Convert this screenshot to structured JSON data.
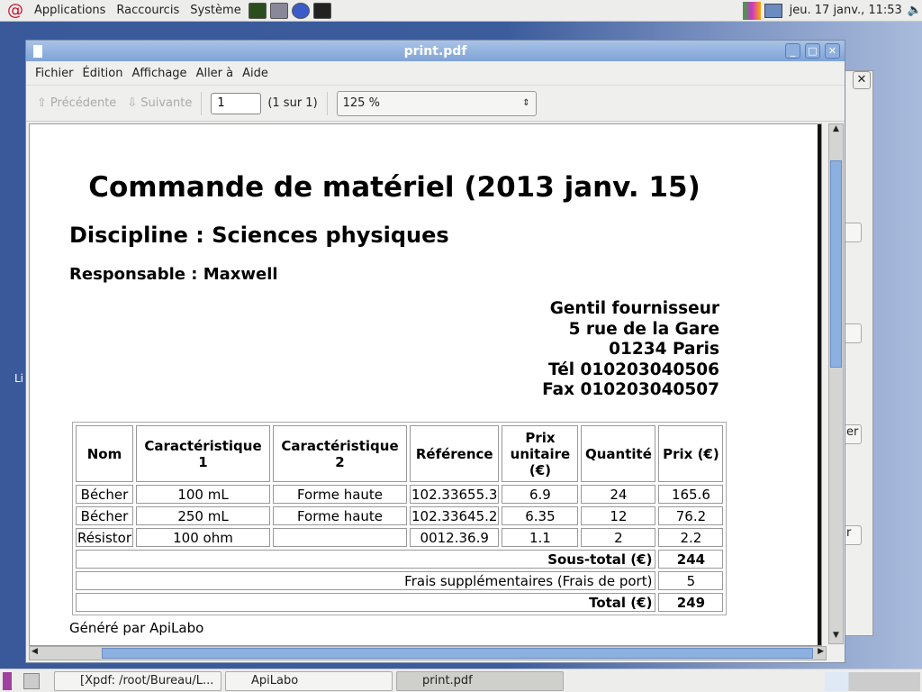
{
  "panel": {
    "menus": [
      "Applications",
      "Raccourcis",
      "Système"
    ],
    "clock": "jeu. 17 janv., 11:53"
  },
  "window": {
    "title": "print.pdf",
    "menu": [
      "Fichier",
      "Édition",
      "Affichage",
      "Aller à",
      "Aide"
    ],
    "toolbar": {
      "prev": "Précédente",
      "next": "Suivante",
      "page": "1",
      "page_of": "(1 sur 1)",
      "zoom": "125 %"
    }
  },
  "document": {
    "title": "Commande de matériel (2013 janv. 15)",
    "discipline": "Discipline : Sciences physiques",
    "responsable": "Responsable : Maxwell",
    "supplier": [
      "Gentil fournisseur",
      "5 rue de la Gare",
      "01234 Paris",
      "Tél 010203040506",
      "Fax 010203040507"
    ],
    "headers": [
      "Nom",
      "Caractéristique 1",
      "Caractéristique 2",
      "Référence",
      "Prix unitaire (€)",
      "Quantité",
      "Prix (€)"
    ],
    "rows": [
      [
        "Bécher",
        "100 mL",
        "Forme haute",
        "102.33655.3",
        "6.9",
        "24",
        "165.6"
      ],
      [
        "Bécher",
        "250 mL",
        "Forme haute",
        "102.33645.2",
        "6.35",
        "12",
        "76.2"
      ],
      [
        "Résistor",
        "100 ohm",
        "",
        "0012.36.9",
        "1.1",
        "2",
        "2.2"
      ]
    ],
    "subtotal_label": "Sous-total (€)",
    "subtotal": "244",
    "fees_label": "Frais supplémentaires (Frais de port)",
    "fees": "5",
    "total_label": "Total (€)",
    "total": "249",
    "footer": "Généré par ApiLabo"
  },
  "background_window": {
    "buttons": [
      "er",
      "r"
    ]
  },
  "taskbar": {
    "tasks": [
      "[Xpdf: /root/Bureau/L...",
      "ApiLabo",
      "print.pdf"
    ]
  },
  "desktop_left_text": "Li"
}
